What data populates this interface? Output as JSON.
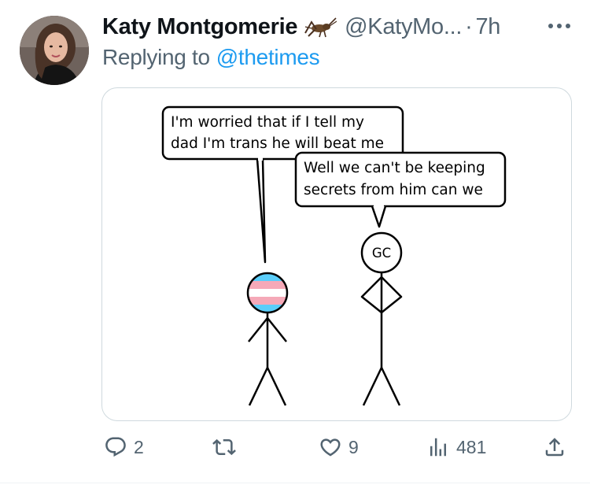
{
  "tweet": {
    "author_name": "Katy Montgomerie",
    "author_badge_icon": "cricket-icon",
    "author_handle": "@KatyMo...",
    "separator": "·",
    "time": "7h",
    "reply_prefix": "Replying to",
    "reply_to_handle": "@thetimes",
    "more_icon": "more-dots-icon"
  },
  "comic": {
    "left_bubble_lines": [
      "I'm worried that if I tell my",
      "dad I'm trans he will beat me"
    ],
    "right_bubble_lines": [
      "Well we can't be keeping",
      "secrets from him can we"
    ],
    "right_figure_head_label": "GC",
    "flag_colors": [
      "#5bcefa",
      "#f5a9b8",
      "#ffffff"
    ]
  },
  "actions": {
    "reply": {
      "icon": "reply-icon",
      "count": "2"
    },
    "retweet": {
      "icon": "retweet-icon",
      "count": ""
    },
    "like": {
      "icon": "heart-icon",
      "count": "9"
    },
    "views": {
      "icon": "views-bar-chart-icon",
      "count": "481"
    },
    "share": {
      "icon": "share-icon"
    }
  },
  "colors": {
    "text_primary": "#0f1419",
    "text_secondary": "#536471",
    "link": "#1d9bf0",
    "border": "#cfd9de"
  }
}
